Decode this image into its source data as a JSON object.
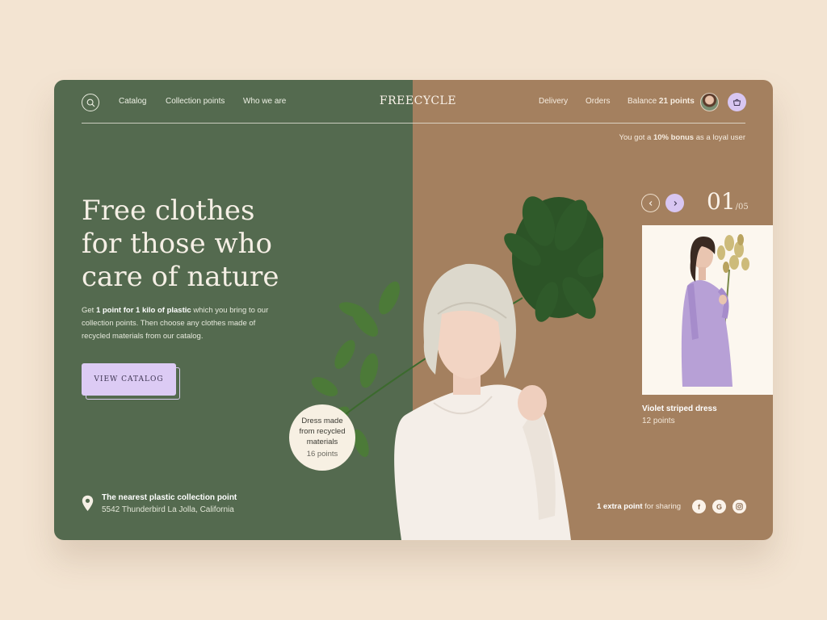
{
  "nav": {
    "links": [
      "Catalog",
      "Collection points",
      "Who we are"
    ],
    "logo": "FREECYCLE",
    "delivery": "Delivery",
    "orders": "Orders",
    "balance_label": "Balance",
    "balance_value": "21 points"
  },
  "bonus": {
    "prefix": "You got a",
    "highlight": "10% bonus",
    "suffix": "as a loyal user"
  },
  "hero": {
    "headline": [
      "Free clothes",
      "for those who",
      "care of nature"
    ],
    "desc_prefix": "Get",
    "desc_highlight": "1 point for 1 kilo of plastic",
    "desc_rest": "which you bring to our collection points. Then choose any clothes made of recycled materials from our catalog.",
    "cta": "VIEW CATALOG"
  },
  "bubble": {
    "text": "Dress made from recycled materials",
    "points": "16 points"
  },
  "location": {
    "title": "The nearest plastic collection point",
    "address": "5542 Thunderbird La Jolla, California"
  },
  "slider": {
    "current": "01",
    "total": "/05"
  },
  "product": {
    "name": "Violet striped dress",
    "points": "12 points"
  },
  "share": {
    "highlight": "1 extra point",
    "rest": "for sharing"
  },
  "icons": {
    "search": "search-icon",
    "cart": "basket-icon",
    "pin": "location-pin-icon",
    "prev": "chevron-left-icon",
    "next": "chevron-right-icon",
    "facebook": "facebook-icon",
    "google": "google-icon",
    "instagram": "instagram-icon"
  },
  "colors": {
    "green": "#546a4f",
    "brown": "#a4805f",
    "lilac": "#d8c6f2",
    "background": "#f3e4d2"
  }
}
